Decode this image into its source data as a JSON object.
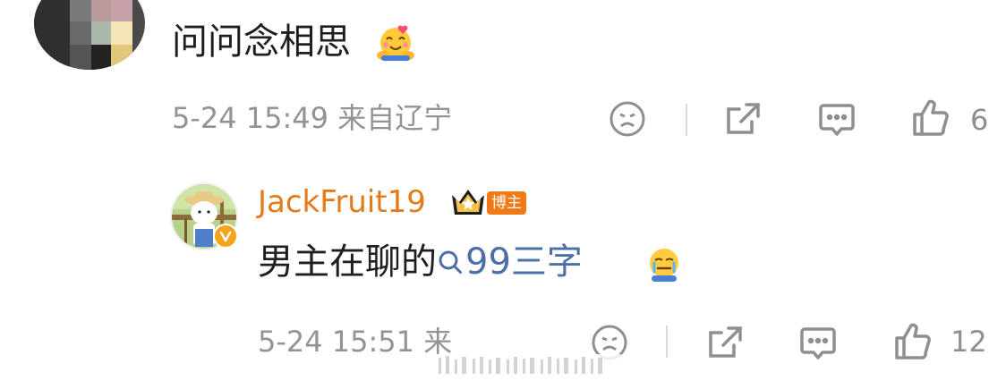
{
  "comment_top": {
    "text": "问问念相思",
    "timestamp": "5-24 15:49",
    "location": "来自辽宁",
    "like_count": "6",
    "emoji": "hug-emoji"
  },
  "reply": {
    "username": "JackFruit19",
    "crown_badge": "crown-badge-icon",
    "badge_label": "博主",
    "text_before_link": "男主在聊的",
    "search_link_label": "99三字",
    "emoji": "crying-emoji",
    "timestamp": "5-24 15:51",
    "location_partial": "来",
    "like_count": "12"
  },
  "colors": {
    "username": "#e57a18",
    "link": "#4d6fa8",
    "meta": "#939393",
    "icon": "#8f8f8f"
  }
}
